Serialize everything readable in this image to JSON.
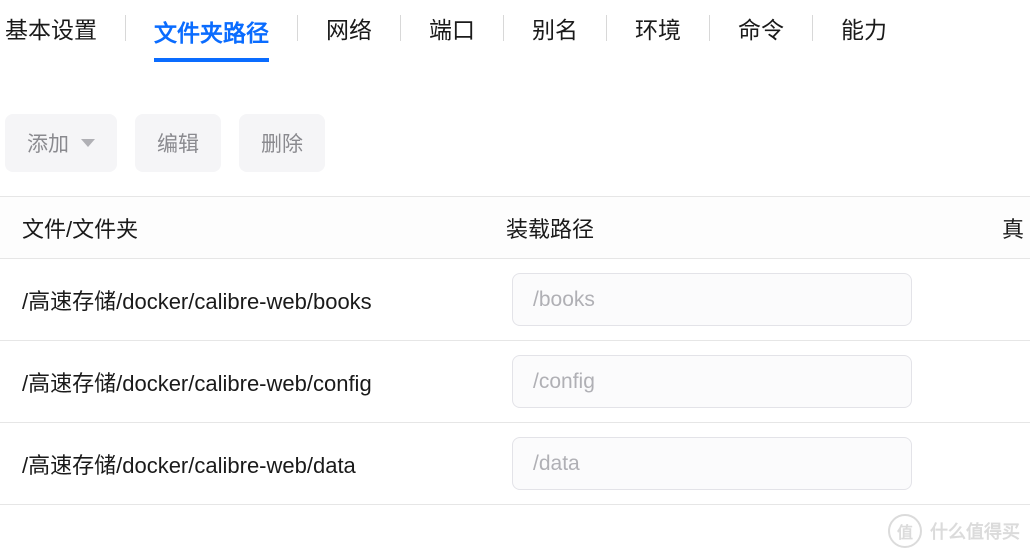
{
  "tabs": [
    {
      "label": "基本设置",
      "active": false
    },
    {
      "label": "文件夹路径",
      "active": true
    },
    {
      "label": "网络",
      "active": false
    },
    {
      "label": "端口",
      "active": false
    },
    {
      "label": "别名",
      "active": false
    },
    {
      "label": "环境",
      "active": false
    },
    {
      "label": "命令",
      "active": false
    },
    {
      "label": "能力",
      "active": false
    }
  ],
  "toolbar": {
    "add_label": "添加",
    "edit_label": "编辑",
    "delete_label": "删除"
  },
  "table": {
    "headers": {
      "file": "文件/文件夹",
      "mount": "装载路径",
      "real": "真"
    },
    "rows": [
      {
        "file": "/高速存储/docker/calibre-web/books",
        "mount": "/books"
      },
      {
        "file": "/高速存储/docker/calibre-web/config",
        "mount": "/config"
      },
      {
        "file": "/高速存储/docker/calibre-web/data",
        "mount": "/data"
      }
    ]
  },
  "watermark": {
    "badge": "值",
    "text": "什么值得买"
  }
}
